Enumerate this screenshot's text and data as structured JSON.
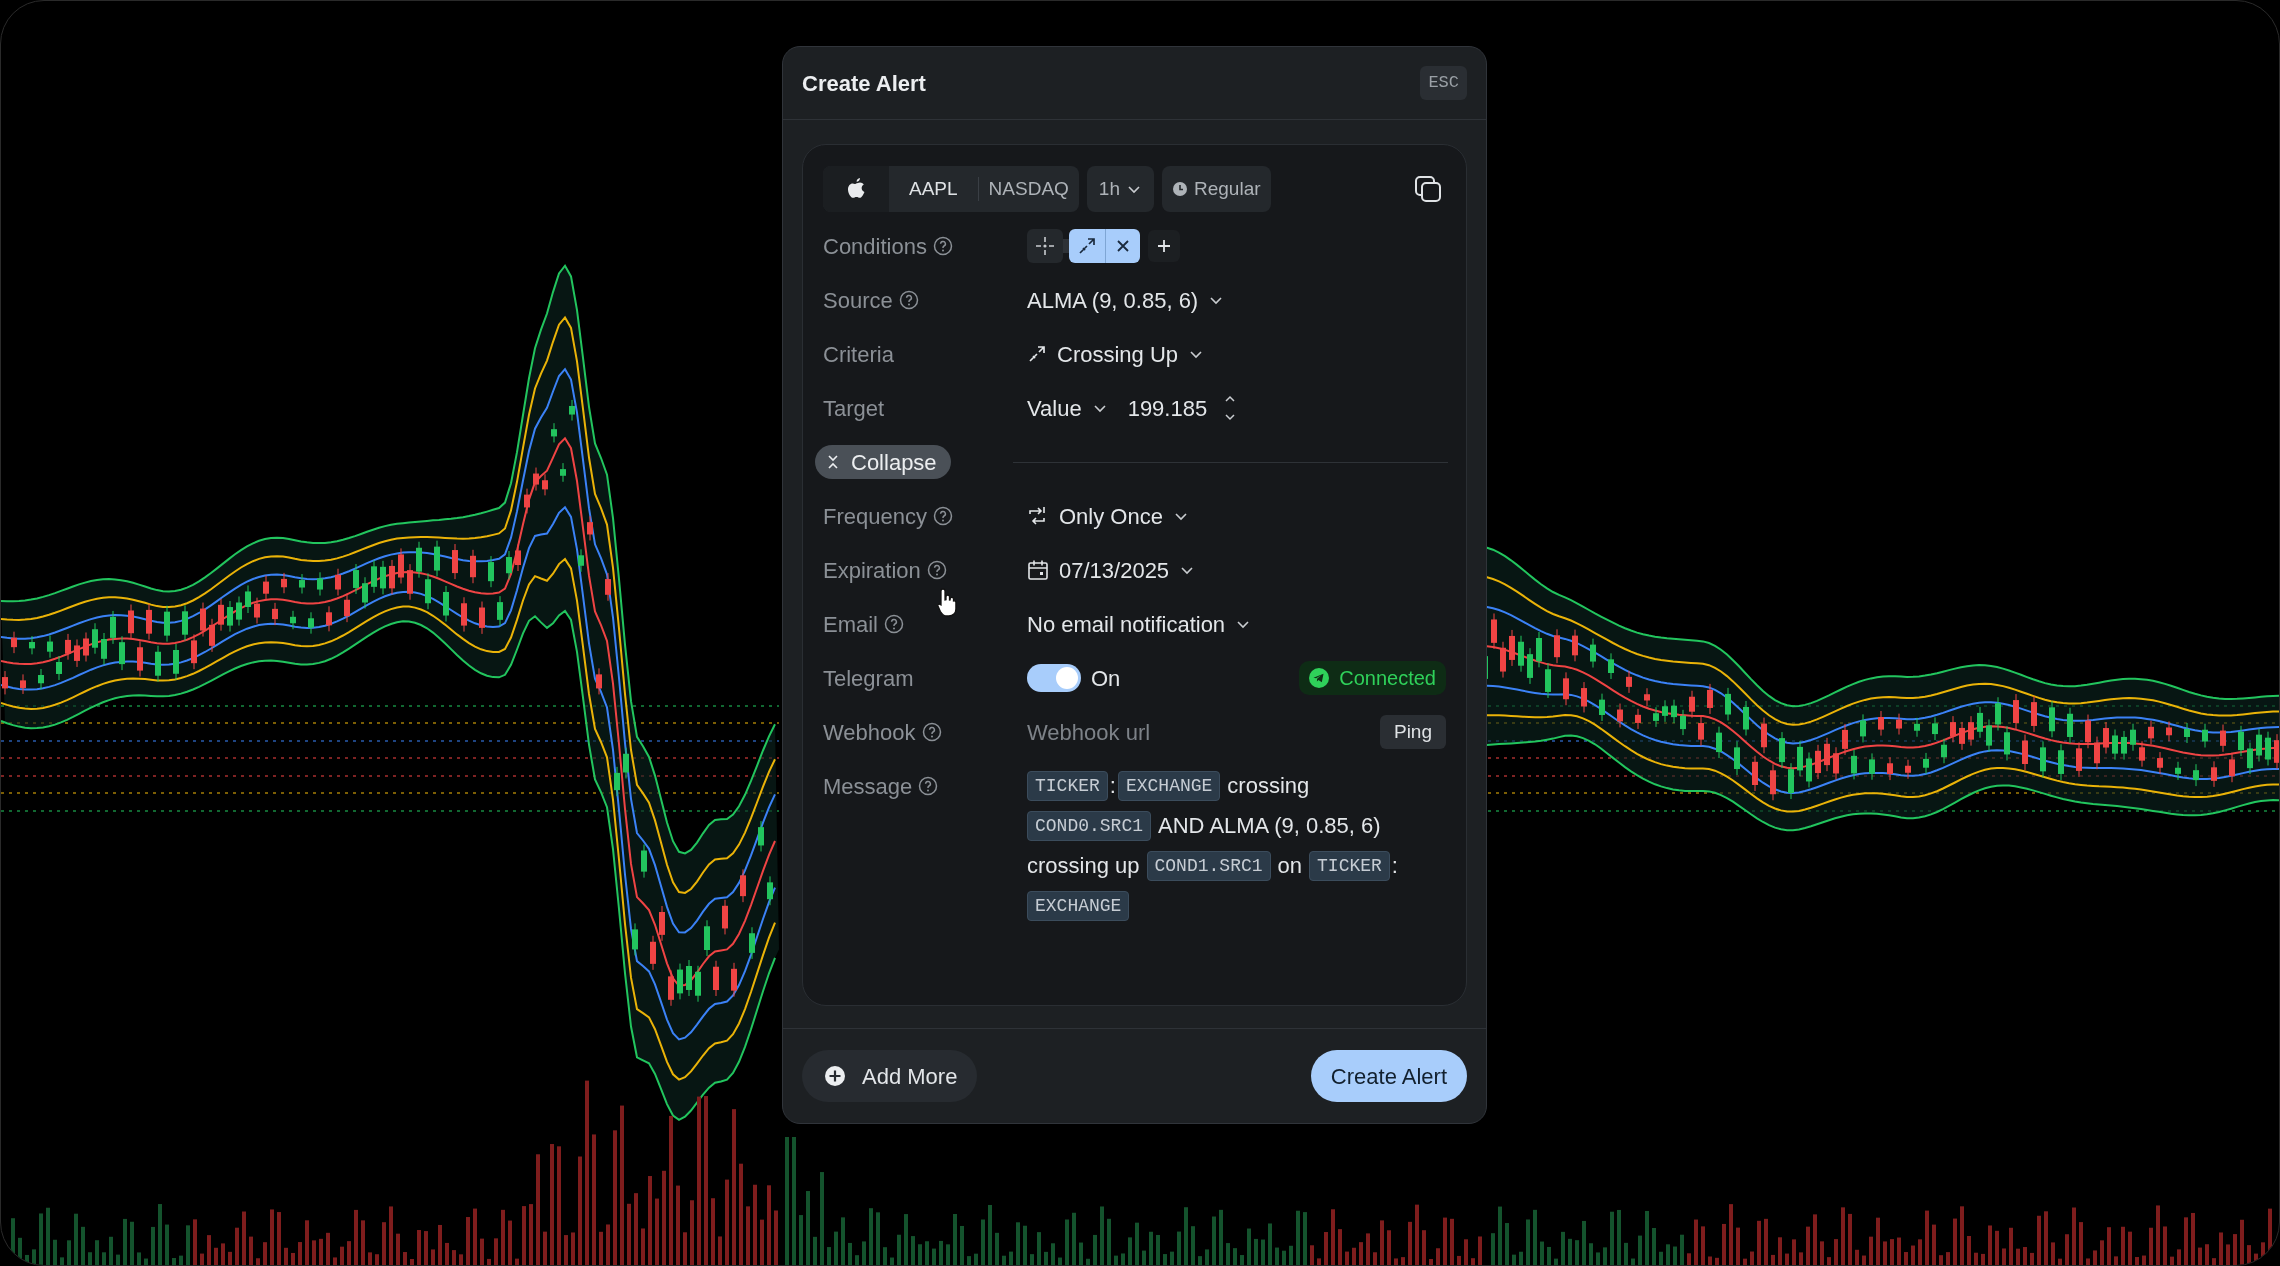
{
  "dialog": {
    "title": "Create Alert",
    "close_key": "ESC"
  },
  "symbol_bar": {
    "ticker": "AAPL",
    "exchange": "NASDAQ",
    "interval": "1h",
    "session": "Regular"
  },
  "conditions": {
    "label": "Conditions",
    "help": true,
    "chips": [
      {
        "kind": "crosshair",
        "selected": false
      },
      {
        "kind": "crossing-up",
        "selected": true
      }
    ]
  },
  "source": {
    "label": "Source",
    "help": true,
    "value": "ALMA (9, 0.85, 6)"
  },
  "criteria": {
    "label": "Criteria",
    "help": false,
    "value": "Crossing Up"
  },
  "target": {
    "label": "Target",
    "help": false,
    "mode": "Value",
    "value": "199.185"
  },
  "collapse": {
    "label": "Collapse"
  },
  "frequency": {
    "label": "Frequency",
    "help": true,
    "value": "Only Once"
  },
  "expiration": {
    "label": "Expiration",
    "help": true,
    "value": "07/13/2025"
  },
  "email": {
    "label": "Email",
    "help": true,
    "value": "No email notification"
  },
  "telegram": {
    "label": "Telegram",
    "help": false,
    "on": true,
    "state_text": "On",
    "status": "Connected"
  },
  "webhook": {
    "label": "Webhook",
    "help": true,
    "placeholder": "Webhook url",
    "button": "Ping"
  },
  "message": {
    "label": "Message",
    "help": true,
    "parts": [
      {
        "kind": "token",
        "text": "TICKER"
      },
      {
        "kind": "punct",
        "text": ":"
      },
      {
        "kind": "token",
        "text": "EXCHANGE"
      },
      {
        "kind": "text",
        "text": "crossing"
      },
      {
        "kind": "token",
        "text": "COND0.SRC1"
      },
      {
        "kind": "text",
        "text": "AND ALMA (9, 0.85, 6)"
      },
      {
        "kind": "text",
        "text": "crossing up"
      },
      {
        "kind": "token",
        "text": "COND1.SRC1"
      },
      {
        "kind": "text",
        "text": "on"
      },
      {
        "kind": "token",
        "text": "TICKER"
      },
      {
        "kind": "punct",
        "text": ":"
      },
      {
        "kind": "token",
        "text": "EXCHANGE"
      }
    ]
  },
  "footer": {
    "add_more": "Add More",
    "create": "Create Alert"
  }
}
